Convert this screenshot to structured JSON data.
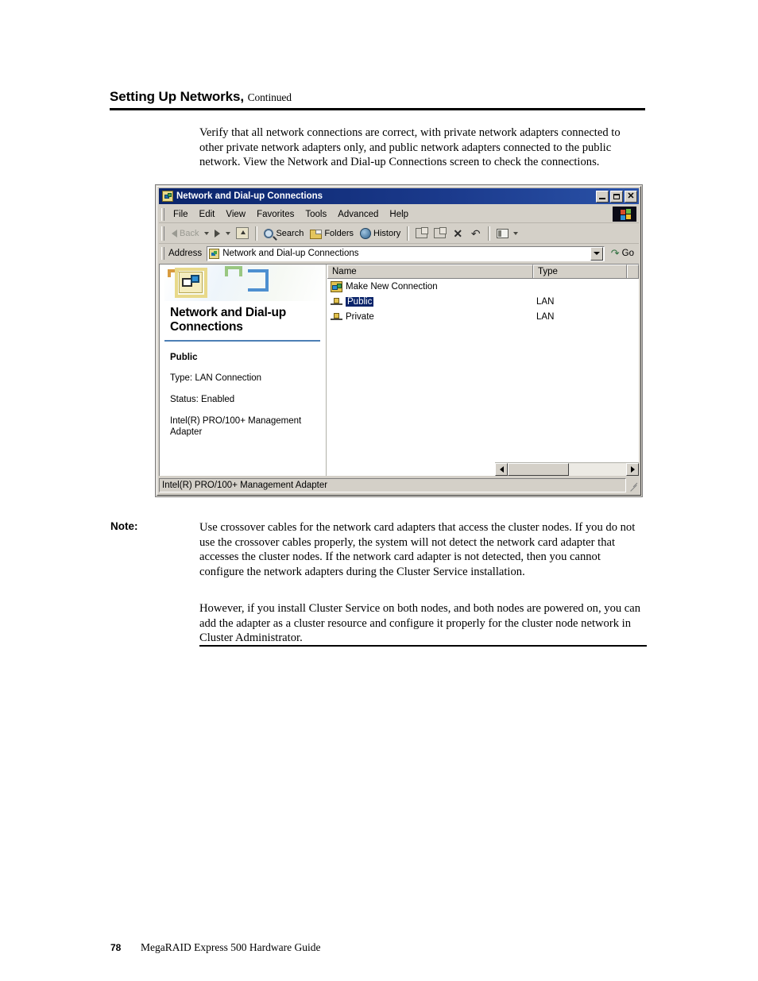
{
  "heading": {
    "title": "Setting Up Networks,",
    "continued": "Continued"
  },
  "intro": "Verify that all network connections are correct, with private network adapters connected to other private network adapters only, and public network adapters connected to the public network. View the Network and Dial-up Connections screen to check the connections.",
  "window": {
    "title": "Network and Dial-up Connections",
    "titlebar_buttons": {
      "minimize": "_",
      "maximize": "□",
      "close": "✕"
    },
    "menu": [
      "File",
      "Edit",
      "View",
      "Favorites",
      "Tools",
      "Advanced",
      "Help"
    ],
    "toolbar": {
      "back": "Back",
      "search": "Search",
      "folders": "Folders",
      "history": "History"
    },
    "address": {
      "label": "Address",
      "value": "Network and Dial-up Connections",
      "go": "Go"
    },
    "left_pane": {
      "title": "Network and Dial-up Connections",
      "selected_name": "Public",
      "type_line": "Type: LAN Connection",
      "status_line": "Status: Enabled",
      "adapter_line": "Intel(R) PRO/100+ Management Adapter"
    },
    "list": {
      "columns": [
        "Name",
        "Type"
      ],
      "rows": [
        {
          "name": "Make New Connection",
          "type": "",
          "icon": "new-connection-icon",
          "selected": false
        },
        {
          "name": "Public",
          "type": "LAN",
          "icon": "lan-connection-icon",
          "selected": true
        },
        {
          "name": "Private",
          "type": "LAN",
          "icon": "lan-connection-icon",
          "selected": false
        }
      ]
    },
    "statusbar": "Intel(R) PRO/100+ Management Adapter"
  },
  "note": {
    "label": "Note:",
    "paragraph1": "Use crossover cables for the network card adapters that access the cluster nodes.  If you do not use the crossover cables properly, the system will not detect the network card adapter that accesses the cluster nodes.  If the network card adapter is not detected, then you cannot configure the network adapters during the Cluster Service installation.",
    "paragraph2": "However, if you install Cluster Service on both nodes, and both nodes are powered on, you can add the adapter as a cluster resource and configure it properly for the cluster node network in Cluster Administrator."
  },
  "footer": {
    "page_number": "78",
    "guide_title": "MegaRAID Express 500 Hardware Guide"
  },
  "colors": {
    "titlebar": "#0a246a",
    "window_face": "#d4d0c8",
    "selection": "#0a246a",
    "left_pane_rule": "#4d7fb5"
  }
}
